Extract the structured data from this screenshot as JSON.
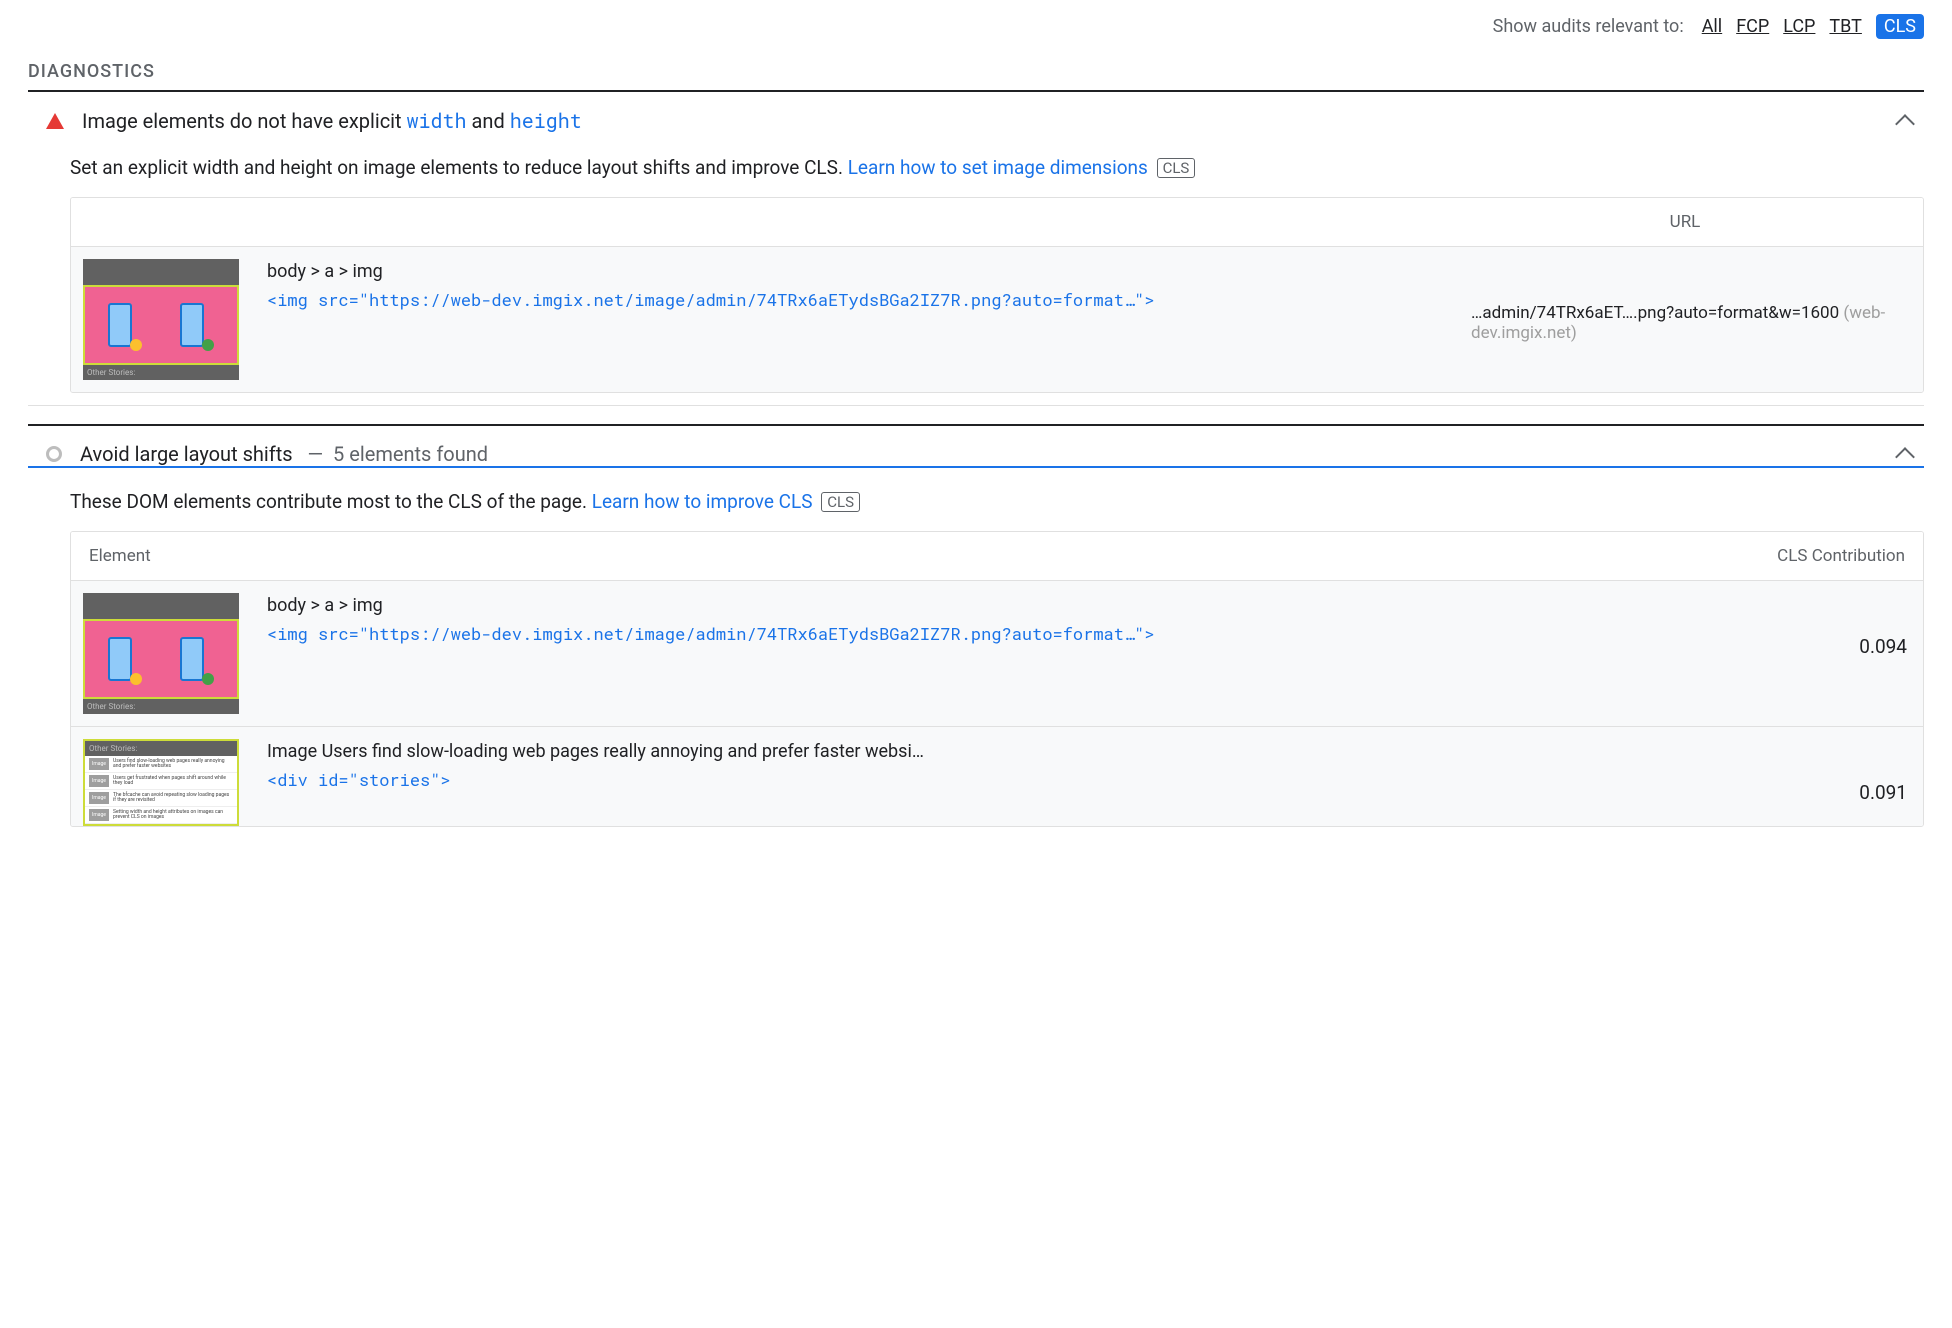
{
  "filter": {
    "label": "Show audits relevant to:",
    "links": [
      "All",
      "FCP",
      "LCP",
      "TBT"
    ],
    "active": "CLS"
  },
  "section_title": "DIAGNOSTICS",
  "audit1": {
    "title_pre": "Image elements do not have explicit ",
    "title_code1": "width",
    "title_mid": " and ",
    "title_code2": "height",
    "desc_pre": "Set an explicit width and height on image elements to reduce layout shifts and improve CLS. ",
    "desc_link": "Learn how to set image dimensions",
    "badge": "CLS",
    "thead_url": "URL",
    "row": {
      "path": "body > a > img",
      "code": "<img src=\"https://web-dev.imgix.net/image/admin/74TRx6aETydsBGa2IZ7R.png?auto=format…\">",
      "url_text": "…admin/74TRx6aET….png?auto=format&w=1600",
      "url_host": "(web-dev.imgix.net)",
      "thumb_label": "Other Stories:"
    }
  },
  "audit2": {
    "title": "Avoid large layout shifts",
    "title_suffix": "5 elements found",
    "dash": "—",
    "desc_pre": "These DOM elements contribute most to the CLS of the page. ",
    "desc_link": "Learn how to improve CLS",
    "badge": "CLS",
    "thead_left": "Element",
    "thead_right": "CLS Contribution",
    "rows": [
      {
        "path": "body > a > img",
        "code": "<img src=\"https://web-dev.imgix.net/image/admin/74TRx6aETydsBGa2IZ7R.png?auto=format…\">",
        "value": "0.094",
        "thumb_label": "Other Stories:"
      },
      {
        "path": "Image Users find slow-loading web pages really annoying and prefer faster websi…",
        "code": "<div id=\"stories\">",
        "value": "0.091",
        "thumb_header": "Other Stories:",
        "stories": [
          "Users find slow-loading web pages really annoying and prefer faster websites",
          "Users get frustrated when pages shift around while they load",
          "The bfcache can avoid repeating slow loading pages if they are revisited",
          "Setting width and height attributes on images can prevent CLS on images"
        ]
      }
    ]
  },
  "thumb_img_label": "Image"
}
